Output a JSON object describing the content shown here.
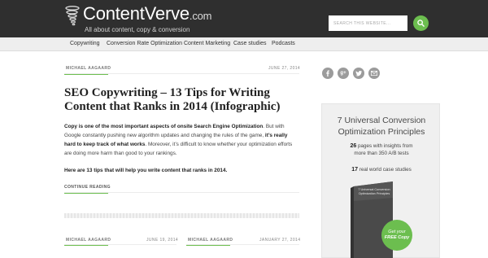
{
  "header": {
    "logo_name": "ContentVerve",
    "logo_tld": ".com",
    "logo_tagline": "All about content, copy & conversion",
    "search_placeholder": "SEARCH THIS WEBSITE...",
    "search_icon": "search-icon"
  },
  "nav": {
    "items": [
      "Copywriting",
      "Conversion Rate Optimization",
      "Content Marketing",
      "Case studies",
      "Podcasts"
    ]
  },
  "featured_post": {
    "author": "MICHAEL AAGAARD",
    "date": "JUNE 27, 2014",
    "title": "SEO Copywriting – 13 Tips for Writing Content that Ranks in 2014 (Infographic)",
    "para1_bold1": "Copy is one of the most important aspects of onsite Search Engine Optimization",
    "para1_text1": ". But with Google constantly pushing new algorithm updates and changing the rules of the game, ",
    "para1_bold2": "it’s really hard to keep track of what works",
    "para1_text2": ". Moreover, it’s difficult to know whether your optimization efforts are doing more harm than good to your rankings.",
    "para2": "Here are 13 tips that will help you write content that ranks in 2014.",
    "continue_label": "CONTINUE READING"
  },
  "secondary_posts": [
    {
      "author": "MICHAEL AAGAARD",
      "date": "JUNE 19, 2014"
    },
    {
      "author": "MICHAEL AAGAARD",
      "date": "JANUARY 27, 2014"
    }
  ],
  "sidebar": {
    "social_icons": [
      "facebook-icon",
      "google-plus-icon",
      "twitter-icon",
      "email-icon"
    ],
    "promo": {
      "title_line1": "7 Universal Conversion",
      "title_line2": "Optimization Principles",
      "stat1_number": "26",
      "stat1_text_a": " pages with insights from",
      "stat1_text_b": "more than 350 A/B tests",
      "stat2_number": "17",
      "stat2_text": " real world case studies",
      "book_title": "7 Universal Conversion Optimization Principles",
      "badge_line1": "Get your",
      "badge_line2": "FREE Copy"
    }
  },
  "colors": {
    "header_bg": "#2f2f2f",
    "accent_green": "#6cbe4f",
    "nav_bg": "#eeeeee",
    "promo_bg": "#f0f0f0"
  }
}
